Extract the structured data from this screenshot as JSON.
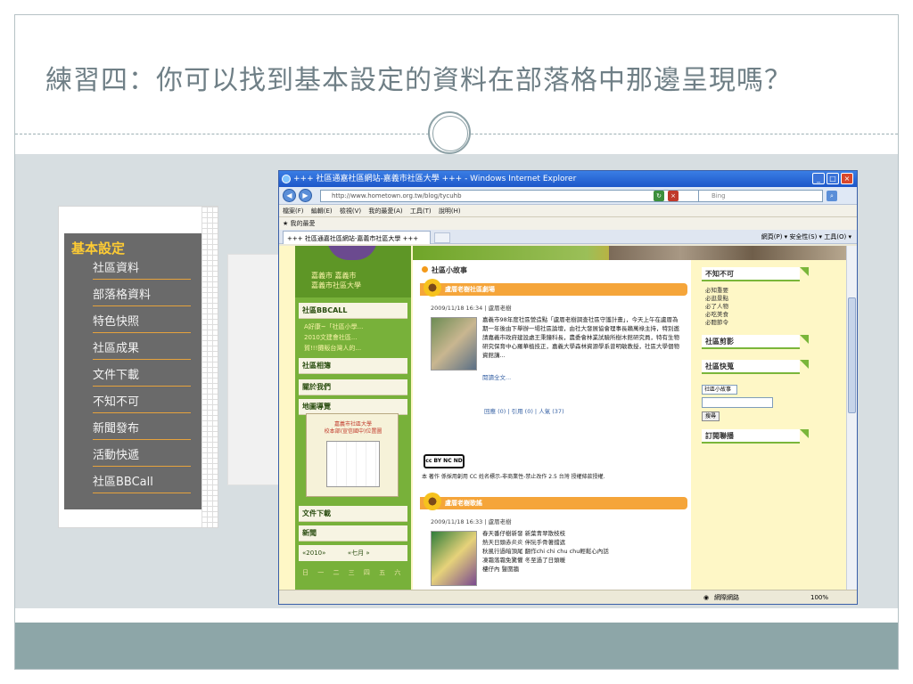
{
  "slide": {
    "title": "練習四：你可以找到基本設定的資料在部落格中那邊呈現嗎？"
  },
  "menu": {
    "heading": "基本設定",
    "items": [
      "社區資料",
      "部落格資料",
      "特色快照",
      "社區成果",
      "文件下載",
      "不知不可",
      "新聞發布",
      "活動快遞",
      "社區BBCall"
    ]
  },
  "browser": {
    "window_title": "+++ 社區通嘉社區網站-嘉義市社區大學 +++ - Windows Internet Explorer",
    "url": "http://www.hometown.org.tw/blog/tycuhb",
    "search_placeholder": "Bing",
    "menu_items": [
      "檔案(F)",
      "編輯(E)",
      "檢視(V)",
      "我的最愛(A)",
      "工具(T)",
      "說明(H)"
    ],
    "favorites_label": "我的最愛",
    "tab_title": "+++ 社區通嘉社區網站-嘉義市社區大學 +++",
    "toolbar_right": "網頁(P) ▾   安全性(S) ▾   工具(O) ▾",
    "status_zone": "網際網路",
    "zoom": "100%"
  },
  "page": {
    "site_title": "嘉義市 嘉義市\n嘉義市社區大學",
    "left": {
      "bbcall_title": "社區BBCALL",
      "bbcall_items": [
        "A好康~「社區小學...",
        "2010文建會社區...",
        "賀!!!攤販台灣人的..."
      ],
      "links_title": "社區相簿",
      "about_title": "關於我們",
      "map_title": "地圖導覽",
      "map_card_text": "嘉義市社區大學\n校本部(宣信國中)位置圖",
      "docs_title": "文件下載",
      "news_title": "新聞",
      "calendar_nav": "«2010»           «七月 »",
      "calendar_days": "日 一 二 三 四 五 六"
    },
    "main": {
      "section_title": "社區小故事",
      "post1_title": "盧厝老樹社區劇場",
      "post1_meta": "2009/11/18 16:34 | 盧厝老樹",
      "post1_text": "嘉義市98年度社區營造點「盧厝老樹調查社區守護計畫」，今天上午在盧厝為期一年後由下舉辦一場社區論壇，由社大發展協會理事長賴萬祿主持，特別邀請嘉義市政府建設處王秉鐘科長，農委會林業試驗所樹木館研究員，特有生物研究保育中心羅華植技正，嘉義大學森林資源學系曾明敏教授，社區大學個物資館講...",
      "post1_more": "閱讀全文...",
      "post1_links": "回應 (0) | 引用 (0) | 人氣 (37)",
      "cc_badge": "cc BY NC ND",
      "license": "本 著作 係採用創用 CC 姓名標示-非商業性-禁止改作 2.5 台灣 授權條款授權.",
      "post2_title": "盧厝老樹歌謠",
      "post2_meta": "2009/11/18 16:33 | 盧厝老樹",
      "post2_text": "春天番仔樹新發 新葉青翠散枝枝\n熱天日頭赤炎炎 伴阮手骨著擋遮\n秋風行過暗頂尾 翻作chi chi chu chu輕鬆心內話\n凍霜落霜免驚懼 冬至過了日頭暖\n樓仔內 豎圍牆"
    },
    "right": {
      "box1_title": "不知不可",
      "box1_items": [
        "必知重要",
        "必逛景點",
        "必了人物",
        "必吃美食",
        "必聽節令"
      ],
      "box2_title": "社區剪影",
      "box3_title": "社區快蒐",
      "select_value": "社區小故事",
      "search_button": "搜尋",
      "box4_title": "訂閱聯播"
    }
  },
  "colors": {
    "title_text": "#6f7f86",
    "menu_bg": "#6a6a6a",
    "menu_heading": "#ffcc33",
    "menu_underline": "#e6a23c",
    "green": "#78b13a",
    "orange": "#f5a53a",
    "footer_band": "#8da6a8"
  }
}
